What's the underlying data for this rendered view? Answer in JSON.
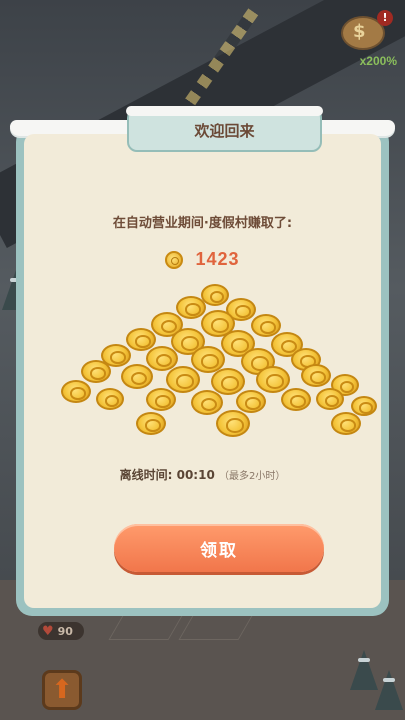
{
  "hud": {
    "piggy_rate": "x200%",
    "piggy_alert": "!",
    "hearts": "90"
  },
  "dialog": {
    "title": "欢迎回来",
    "subtitle": "在自动营业期间·度假村赚取了:",
    "amount": "1423",
    "offline_label": "离线时间: 00:10",
    "offline_max": "（最多2小时）",
    "claim_label": "领取"
  },
  "colors": {
    "accent": "#f1764b",
    "amount": "#e0643d",
    "panel": "#f2ebd9",
    "frame": "#9cc2c0"
  }
}
